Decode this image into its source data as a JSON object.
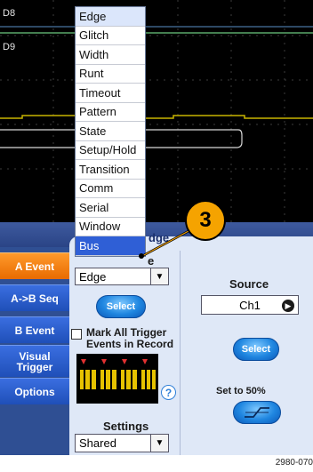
{
  "scope": {
    "channel_top": "D8",
    "channel_second": "D9"
  },
  "trigger_type_menu": {
    "items": [
      "Edge",
      "Glitch",
      "Width",
      "Runt",
      "Timeout",
      "Pattern",
      "State",
      "Setup/Hold",
      "Transition",
      "Comm",
      "Serial",
      "Window",
      "Bus"
    ],
    "selected": "Bus"
  },
  "panel": {
    "title_partial": "dge",
    "type_label_partial": "e",
    "type_value": "Edge",
    "select_label": "Select",
    "mark_all_label_line1": "Mark All Trigger",
    "mark_all_label_line2": "Events in Record",
    "help_glyph": "?",
    "settings_label": "Settings",
    "settings_value": "Shared",
    "source_label": "Source",
    "source_value": "Ch1",
    "source_select_label": "Select",
    "set_to_50_label": "Set to 50%"
  },
  "side_tabs": [
    {
      "label": "A Event",
      "active": true
    },
    {
      "label": "A->B Seq",
      "active": false
    },
    {
      "label": "B Event",
      "active": false
    },
    {
      "label": "Visual Trigger",
      "active": false
    },
    {
      "label": "Options",
      "active": false
    }
  ],
  "callout": {
    "number": "3"
  },
  "figure_id": "2980-070",
  "colors": {
    "active_tab": "#f28a10",
    "tab_blue": "#2a5fd0",
    "panel_bg": "#dfe8f7",
    "selected_item": "#2f5fd6",
    "callout": "#f5a300",
    "waveform": "#c8b400"
  }
}
